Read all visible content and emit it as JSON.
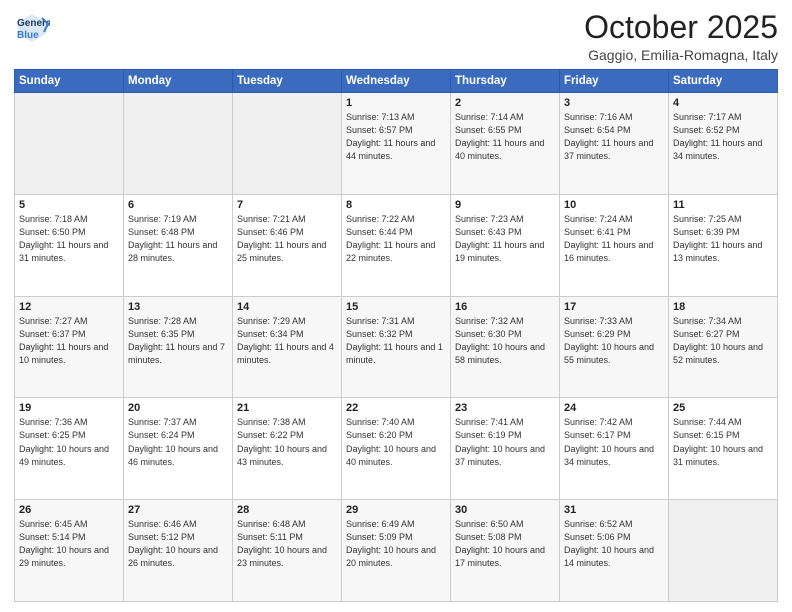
{
  "header": {
    "logo_line1": "General",
    "logo_line2": "Blue",
    "month": "October 2025",
    "location": "Gaggio, Emilia-Romagna, Italy"
  },
  "weekdays": [
    "Sunday",
    "Monday",
    "Tuesday",
    "Wednesday",
    "Thursday",
    "Friday",
    "Saturday"
  ],
  "weeks": [
    [
      {
        "day": "",
        "sunrise": "",
        "sunset": "",
        "daylight": ""
      },
      {
        "day": "",
        "sunrise": "",
        "sunset": "",
        "daylight": ""
      },
      {
        "day": "",
        "sunrise": "",
        "sunset": "",
        "daylight": ""
      },
      {
        "day": "1",
        "sunrise": "Sunrise: 7:13 AM",
        "sunset": "Sunset: 6:57 PM",
        "daylight": "Daylight: 11 hours and 44 minutes."
      },
      {
        "day": "2",
        "sunrise": "Sunrise: 7:14 AM",
        "sunset": "Sunset: 6:55 PM",
        "daylight": "Daylight: 11 hours and 40 minutes."
      },
      {
        "day": "3",
        "sunrise": "Sunrise: 7:16 AM",
        "sunset": "Sunset: 6:54 PM",
        "daylight": "Daylight: 11 hours and 37 minutes."
      },
      {
        "day": "4",
        "sunrise": "Sunrise: 7:17 AM",
        "sunset": "Sunset: 6:52 PM",
        "daylight": "Daylight: 11 hours and 34 minutes."
      }
    ],
    [
      {
        "day": "5",
        "sunrise": "Sunrise: 7:18 AM",
        "sunset": "Sunset: 6:50 PM",
        "daylight": "Daylight: 11 hours and 31 minutes."
      },
      {
        "day": "6",
        "sunrise": "Sunrise: 7:19 AM",
        "sunset": "Sunset: 6:48 PM",
        "daylight": "Daylight: 11 hours and 28 minutes."
      },
      {
        "day": "7",
        "sunrise": "Sunrise: 7:21 AM",
        "sunset": "Sunset: 6:46 PM",
        "daylight": "Daylight: 11 hours and 25 minutes."
      },
      {
        "day": "8",
        "sunrise": "Sunrise: 7:22 AM",
        "sunset": "Sunset: 6:44 PM",
        "daylight": "Daylight: 11 hours and 22 minutes."
      },
      {
        "day": "9",
        "sunrise": "Sunrise: 7:23 AM",
        "sunset": "Sunset: 6:43 PM",
        "daylight": "Daylight: 11 hours and 19 minutes."
      },
      {
        "day": "10",
        "sunrise": "Sunrise: 7:24 AM",
        "sunset": "Sunset: 6:41 PM",
        "daylight": "Daylight: 11 hours and 16 minutes."
      },
      {
        "day": "11",
        "sunrise": "Sunrise: 7:25 AM",
        "sunset": "Sunset: 6:39 PM",
        "daylight": "Daylight: 11 hours and 13 minutes."
      }
    ],
    [
      {
        "day": "12",
        "sunrise": "Sunrise: 7:27 AM",
        "sunset": "Sunset: 6:37 PM",
        "daylight": "Daylight: 11 hours and 10 minutes."
      },
      {
        "day": "13",
        "sunrise": "Sunrise: 7:28 AM",
        "sunset": "Sunset: 6:35 PM",
        "daylight": "Daylight: 11 hours and 7 minutes."
      },
      {
        "day": "14",
        "sunrise": "Sunrise: 7:29 AM",
        "sunset": "Sunset: 6:34 PM",
        "daylight": "Daylight: 11 hours and 4 minutes."
      },
      {
        "day": "15",
        "sunrise": "Sunrise: 7:31 AM",
        "sunset": "Sunset: 6:32 PM",
        "daylight": "Daylight: 11 hours and 1 minute."
      },
      {
        "day": "16",
        "sunrise": "Sunrise: 7:32 AM",
        "sunset": "Sunset: 6:30 PM",
        "daylight": "Daylight: 10 hours and 58 minutes."
      },
      {
        "day": "17",
        "sunrise": "Sunrise: 7:33 AM",
        "sunset": "Sunset: 6:29 PM",
        "daylight": "Daylight: 10 hours and 55 minutes."
      },
      {
        "day": "18",
        "sunrise": "Sunrise: 7:34 AM",
        "sunset": "Sunset: 6:27 PM",
        "daylight": "Daylight: 10 hours and 52 minutes."
      }
    ],
    [
      {
        "day": "19",
        "sunrise": "Sunrise: 7:36 AM",
        "sunset": "Sunset: 6:25 PM",
        "daylight": "Daylight: 10 hours and 49 minutes."
      },
      {
        "day": "20",
        "sunrise": "Sunrise: 7:37 AM",
        "sunset": "Sunset: 6:24 PM",
        "daylight": "Daylight: 10 hours and 46 minutes."
      },
      {
        "day": "21",
        "sunrise": "Sunrise: 7:38 AM",
        "sunset": "Sunset: 6:22 PM",
        "daylight": "Daylight: 10 hours and 43 minutes."
      },
      {
        "day": "22",
        "sunrise": "Sunrise: 7:40 AM",
        "sunset": "Sunset: 6:20 PM",
        "daylight": "Daylight: 10 hours and 40 minutes."
      },
      {
        "day": "23",
        "sunrise": "Sunrise: 7:41 AM",
        "sunset": "Sunset: 6:19 PM",
        "daylight": "Daylight: 10 hours and 37 minutes."
      },
      {
        "day": "24",
        "sunrise": "Sunrise: 7:42 AM",
        "sunset": "Sunset: 6:17 PM",
        "daylight": "Daylight: 10 hours and 34 minutes."
      },
      {
        "day": "25",
        "sunrise": "Sunrise: 7:44 AM",
        "sunset": "Sunset: 6:15 PM",
        "daylight": "Daylight: 10 hours and 31 minutes."
      }
    ],
    [
      {
        "day": "26",
        "sunrise": "Sunrise: 6:45 AM",
        "sunset": "Sunset: 5:14 PM",
        "daylight": "Daylight: 10 hours and 29 minutes."
      },
      {
        "day": "27",
        "sunrise": "Sunrise: 6:46 AM",
        "sunset": "Sunset: 5:12 PM",
        "daylight": "Daylight: 10 hours and 26 minutes."
      },
      {
        "day": "28",
        "sunrise": "Sunrise: 6:48 AM",
        "sunset": "Sunset: 5:11 PM",
        "daylight": "Daylight: 10 hours and 23 minutes."
      },
      {
        "day": "29",
        "sunrise": "Sunrise: 6:49 AM",
        "sunset": "Sunset: 5:09 PM",
        "daylight": "Daylight: 10 hours and 20 minutes."
      },
      {
        "day": "30",
        "sunrise": "Sunrise: 6:50 AM",
        "sunset": "Sunset: 5:08 PM",
        "daylight": "Daylight: 10 hours and 17 minutes."
      },
      {
        "day": "31",
        "sunrise": "Sunrise: 6:52 AM",
        "sunset": "Sunset: 5:06 PM",
        "daylight": "Daylight: 10 hours and 14 minutes."
      },
      {
        "day": "",
        "sunrise": "",
        "sunset": "",
        "daylight": ""
      }
    ]
  ]
}
